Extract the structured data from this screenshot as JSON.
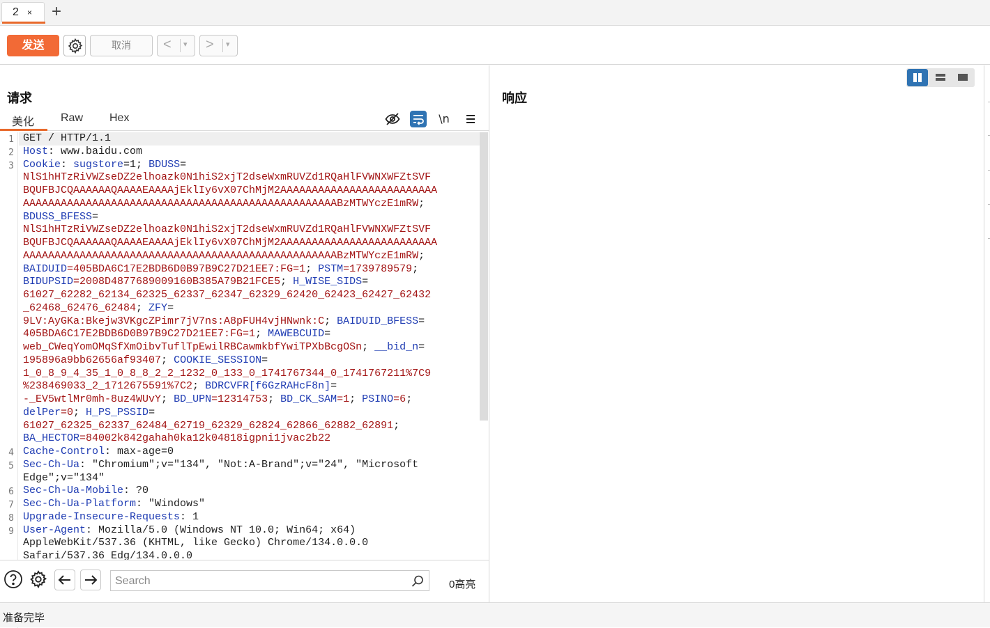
{
  "tabs": [
    {
      "label": "2",
      "close": "×"
    }
  ],
  "new_tab": "+",
  "toolbar": {
    "send_label": "发送",
    "cancel_label": "取消",
    "back_arrow": "<",
    "forward_arrow": ">",
    "dropdown_glyph": "▾"
  },
  "request": {
    "title": "请求",
    "tabs": [
      "美化",
      "Raw",
      "Hex"
    ],
    "active_tab": "美化",
    "newline_toggle": "\\n",
    "line_numbers": [
      {
        "n": "1",
        "row": 0
      },
      {
        "n": "2",
        "row": 1
      },
      {
        "n": "3",
        "row": 2
      },
      {
        "n": "4",
        "row": 24
      },
      {
        "n": "5",
        "row": 25
      },
      {
        "n": "6",
        "row": 27
      },
      {
        "n": "7",
        "row": 28
      },
      {
        "n": "8",
        "row": 29
      },
      {
        "n": "9",
        "row": 30
      }
    ],
    "lines": [
      [
        {
          "t": "GET / HTTP/1.1",
          "c": ""
        }
      ],
      [
        {
          "t": "Host",
          "c": "k"
        },
        {
          "t": ": www.baidu.com",
          "c": ""
        }
      ],
      [
        {
          "t": "Cookie",
          "c": "k"
        },
        {
          "t": ": ",
          "c": ""
        },
        {
          "t": "sugstore",
          "c": "k"
        },
        {
          "t": "=1; ",
          "c": ""
        },
        {
          "t": "BDUSS",
          "c": "k"
        },
        {
          "t": "=",
          "c": ""
        }
      ],
      [
        {
          "t": "NlS1hHTzRiVWZseDZ2elhoazk0N1hiS2xjT2dseWxmRUVZd1RQaHlFVWNXWFZtSVF",
          "c": "v"
        }
      ],
      [
        {
          "t": "BQUFBJCQAAAAAAQAAAAEAAAAjEklIy6vX07ChMjM2AAAAAAAAAAAAAAAAAAAAAAAAA",
          "c": "v"
        }
      ],
      [
        {
          "t": "AAAAAAAAAAAAAAAAAAAAAAAAAAAAAAAAAAAAAAAAAAAAAAAAAABzMTWYczE1mRW",
          "c": "v"
        },
        {
          "t": ";",
          "c": ""
        }
      ],
      [
        {
          "t": "BDUSS_BFESS",
          "c": "k"
        },
        {
          "t": "=",
          "c": ""
        }
      ],
      [
        {
          "t": "NlS1hHTzRiVWZseDZ2elhoazk0N1hiS2xjT2dseWxmRUVZd1RQaHlFVWNXWFZtSVF",
          "c": "v"
        }
      ],
      [
        {
          "t": "BQUFBJCQAAAAAAQAAAAEAAAAjEklIy6vX07ChMjM2AAAAAAAAAAAAAAAAAAAAAAAAA",
          "c": "v"
        }
      ],
      [
        {
          "t": "AAAAAAAAAAAAAAAAAAAAAAAAAAAAAAAAAAAAAAAAAAAAAAAAAABzMTWYczE1mRW",
          "c": "v"
        },
        {
          "t": ";",
          "c": ""
        }
      ],
      [
        {
          "t": "BAIDUID",
          "c": "k"
        },
        {
          "t": "=405BDA6C17E2BDB6D0B97B9C27D21EE7:FG=1",
          "c": "v"
        },
        {
          "t": "; ",
          "c": ""
        },
        {
          "t": "PSTM",
          "c": "k"
        },
        {
          "t": "=1739789579",
          "c": "v"
        },
        {
          "t": ";",
          "c": ""
        }
      ],
      [
        {
          "t": "BIDUPSID",
          "c": "k"
        },
        {
          "t": "=2008D4877689009160B385A79B21FCE5",
          "c": "v"
        },
        {
          "t": "; ",
          "c": ""
        },
        {
          "t": "H_WISE_SIDS",
          "c": "k"
        },
        {
          "t": "=",
          "c": ""
        }
      ],
      [
        {
          "t": "61027_62282_62134_62325_62337_62347_62329_62420_62423_62427_62432",
          "c": "v"
        }
      ],
      [
        {
          "t": "_62468_62476_62484",
          "c": "v"
        },
        {
          "t": "; ",
          "c": ""
        },
        {
          "t": "ZFY",
          "c": "k"
        },
        {
          "t": "=",
          "c": ""
        }
      ],
      [
        {
          "t": "9LV:AyGKa:Bkejw3VKgcZPimr7jV7ns:A8pFUH4vjHNwnk:C",
          "c": "v"
        },
        {
          "t": "; ",
          "c": ""
        },
        {
          "t": "BAIDUID_BFESS",
          "c": "k"
        },
        {
          "t": "=",
          "c": ""
        }
      ],
      [
        {
          "t": "405BDA6C17E2BDB6D0B97B9C27D21EE7:FG=1",
          "c": "v"
        },
        {
          "t": "; ",
          "c": ""
        },
        {
          "t": "MAWEBCUID",
          "c": "k"
        },
        {
          "t": "=",
          "c": ""
        }
      ],
      [
        {
          "t": "web_CWeqYomOMqSfXmOibvTuflTpEwilRBCawmkbfYwiTPXbBcgOSn",
          "c": "v"
        },
        {
          "t": "; ",
          "c": ""
        },
        {
          "t": "__bid_n",
          "c": "k"
        },
        {
          "t": "=",
          "c": ""
        }
      ],
      [
        {
          "t": "195896a9bb62656af93407",
          "c": "v"
        },
        {
          "t": "; ",
          "c": ""
        },
        {
          "t": "COOKIE_SESSION",
          "c": "k"
        },
        {
          "t": "=",
          "c": ""
        }
      ],
      [
        {
          "t": "1_0_8_9_4_35_1_0_8_8_2_2_1232_0_133_0_1741767344_0_1741767211%7C9",
          "c": "v"
        }
      ],
      [
        {
          "t": "%238469033_2_1712675591%7C2",
          "c": "v"
        },
        {
          "t": "; ",
          "c": ""
        },
        {
          "t": "BDRCVFR[f6GzRAHcF8n]",
          "c": "k"
        },
        {
          "t": "=",
          "c": ""
        }
      ],
      [
        {
          "t": "-_EV5wtlMr0mh-8uz4WUvY",
          "c": "v"
        },
        {
          "t": "; ",
          "c": ""
        },
        {
          "t": "BD_UPN",
          "c": "k"
        },
        {
          "t": "=12314753",
          "c": "v"
        },
        {
          "t": "; ",
          "c": ""
        },
        {
          "t": "BD_CK_SAM",
          "c": "k"
        },
        {
          "t": "=1",
          "c": "v"
        },
        {
          "t": "; ",
          "c": ""
        },
        {
          "t": "PSINO",
          "c": "k"
        },
        {
          "t": "=6",
          "c": "v"
        },
        {
          "t": ";",
          "c": ""
        }
      ],
      [
        {
          "t": "delPer",
          "c": "k"
        },
        {
          "t": "=0",
          "c": "v"
        },
        {
          "t": "; ",
          "c": ""
        },
        {
          "t": "H_PS_PSSID",
          "c": "k"
        },
        {
          "t": "=",
          "c": ""
        }
      ],
      [
        {
          "t": "61027_62325_62337_62484_62719_62329_62824_62866_62882_62891",
          "c": "v"
        },
        {
          "t": ";",
          "c": ""
        }
      ],
      [
        {
          "t": "BA_HECTOR",
          "c": "k"
        },
        {
          "t": "=84002k842gahah0ka12k04818igpni1jvac2b22",
          "c": "v"
        }
      ],
      [
        {
          "t": "Cache-Control",
          "c": "k"
        },
        {
          "t": ": max-age=0",
          "c": ""
        }
      ],
      [
        {
          "t": "Sec-Ch-Ua",
          "c": "k"
        },
        {
          "t": ": \"Chromium\";v=\"134\", \"Not:A-Brand\";v=\"24\", \"Microsoft",
          "c": ""
        }
      ],
      [
        {
          "t": "Edge\";v=\"134\"",
          "c": ""
        }
      ],
      [
        {
          "t": "Sec-Ch-Ua-Mobile",
          "c": "k"
        },
        {
          "t": ": ?0",
          "c": ""
        }
      ],
      [
        {
          "t": "Sec-Ch-Ua-Platform",
          "c": "k"
        },
        {
          "t": ": \"Windows\"",
          "c": ""
        }
      ],
      [
        {
          "t": "Upgrade-Insecure-Requests",
          "c": "k"
        },
        {
          "t": ": 1",
          "c": ""
        }
      ],
      [
        {
          "t": "User-Agent",
          "c": "k"
        },
        {
          "t": ": Mozilla/5.0 (Windows NT 10.0; Win64; x64)",
          "c": ""
        }
      ],
      [
        {
          "t": "AppleWebKit/537.36 (KHTML, like Gecko) Chrome/134.0.0.0",
          "c": ""
        }
      ],
      [
        {
          "t": "Safari/537.36 Edg/134.0.0.0",
          "c": ""
        }
      ]
    ]
  },
  "search": {
    "placeholder": "Search",
    "value": "",
    "highlight_count": "0高亮"
  },
  "response": {
    "title": "响应"
  },
  "status": "准备完毕",
  "colors": {
    "accent": "#f26a36",
    "header_key": "#1f3cb3",
    "cookie_value": "#a31515",
    "active_blue": "#2f73b3"
  }
}
